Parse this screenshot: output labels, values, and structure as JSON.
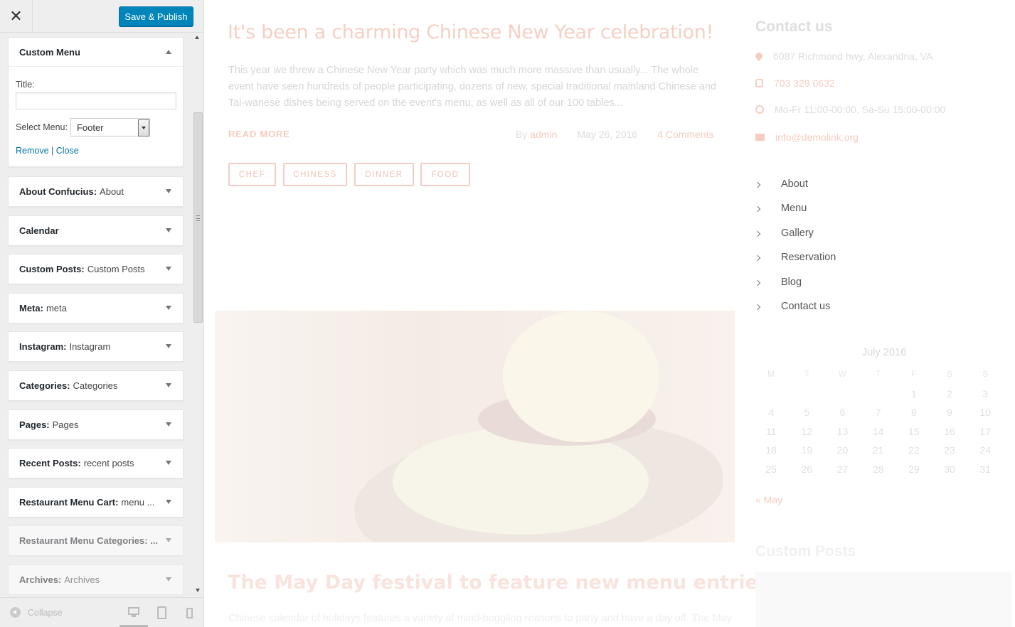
{
  "header": {
    "close_glyph": "✕",
    "save_label": "Save & Publish"
  },
  "widgets": [
    {
      "title": "Custom Menu",
      "subtitle": "",
      "expanded": true
    },
    {
      "title": "About Confucius:",
      "subtitle": "About"
    },
    {
      "title": "Calendar",
      "subtitle": ""
    },
    {
      "title": "Custom Posts:",
      "subtitle": "Custom Posts"
    },
    {
      "title": "Meta:",
      "subtitle": "meta"
    },
    {
      "title": "Instagram:",
      "subtitle": "Instagram"
    },
    {
      "title": "Categories:",
      "subtitle": "Categories"
    },
    {
      "title": "Pages:",
      "subtitle": "Pages"
    },
    {
      "title": "Recent Posts:",
      "subtitle": "recent posts"
    },
    {
      "title": "Restaurant Menu Cart:",
      "subtitle": "menu ..."
    },
    {
      "title": "Restaurant Menu Categories: ...",
      "subtitle": ""
    },
    {
      "title": "Archives:",
      "subtitle": "Archives"
    }
  ],
  "custom_menu_form": {
    "title_label": "Title:",
    "title_value": "",
    "select_label": "Select Menu:",
    "select_value": "Footer",
    "remove_label": "Remove",
    "separator": "|",
    "close_label": "Close"
  },
  "footer": {
    "collapse_label": "Collapse",
    "devices": [
      "desktop-icon",
      "tablet-icon",
      "mobile-icon"
    ]
  },
  "preview": {
    "post1": {
      "title": "It's been a charming Chinese New Year celebration!",
      "excerpt": "This year we threw a Chinese New Year party which was much more massive than usually... The whole event have seen hundreds of people participating, dozens of new, special traditional mainland Chinese and Tai-wanese dishes being served on the event's menu, as well as all of our 100 tables...",
      "read_more": "READ MORE",
      "by": "By",
      "author": "admin",
      "date": "May 26, 2016",
      "comments": "4 Comments",
      "tags": [
        "CHEF",
        "CHINESS",
        "DINNER",
        "FOOD"
      ]
    },
    "post2": {
      "title": "The May Day festival to feature new menu entries!",
      "excerpt": "Chinese calendar of holidays features a variety of mind-boggling reasons to party and have a day off. The May"
    },
    "contact": {
      "title": "Contact us",
      "address": "6087 Richmond hwy, Alexandria, VA",
      "phone": "703 329 0632",
      "hours": "Mo-Fr 11:00-00:00, Sa-Su 15:00-00:00",
      "email": "info@demolink.org"
    },
    "nav": [
      "About",
      "Menu",
      "Gallery",
      "Reservation",
      "Blog",
      "Contact us"
    ],
    "calendar": {
      "caption": "July 2016",
      "weekdays": [
        "M",
        "T",
        "W",
        "T",
        "F",
        "S",
        "S"
      ],
      "weeks": [
        [
          "",
          "",
          "",
          "",
          "1",
          "2",
          "3"
        ],
        [
          "4",
          "5",
          "6",
          "7",
          "8",
          "9",
          "10"
        ],
        [
          "11",
          "12",
          "13",
          "14",
          "15",
          "16",
          "17"
        ],
        [
          "18",
          "19",
          "20",
          "21",
          "22",
          "23",
          "24"
        ],
        [
          "25",
          "26",
          "27",
          "28",
          "29",
          "30",
          "31"
        ]
      ],
      "prev": "« May"
    },
    "custom_posts_title": "Custom Posts"
  }
}
